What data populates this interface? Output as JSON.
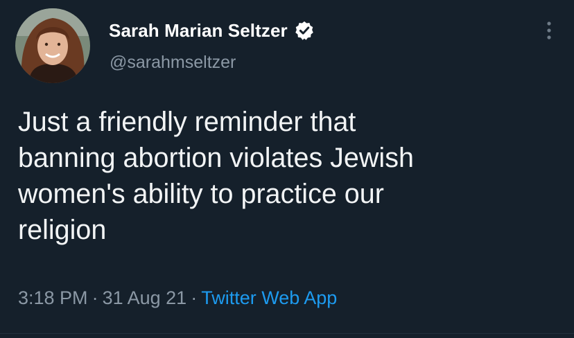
{
  "tweet": {
    "author": {
      "display_name": "Sarah Marian Seltzer",
      "handle": "@sarahmseltzer",
      "verified": true
    },
    "text": "Just a friendly reminder that\nbanning abortion violates Jewish\nwomen's ability to practice our\nreligion",
    "time": "3:18 PM",
    "separator": "·",
    "date": "31 Aug 21",
    "source": "Twitter Web App"
  },
  "colors": {
    "background": "#15202b",
    "text_primary": "#ffffff",
    "text_secondary": "#8b98a5",
    "accent": "#1d9bf0"
  },
  "icons": [
    "avatar-photo",
    "verified-badge-icon",
    "more-options-icon"
  ]
}
